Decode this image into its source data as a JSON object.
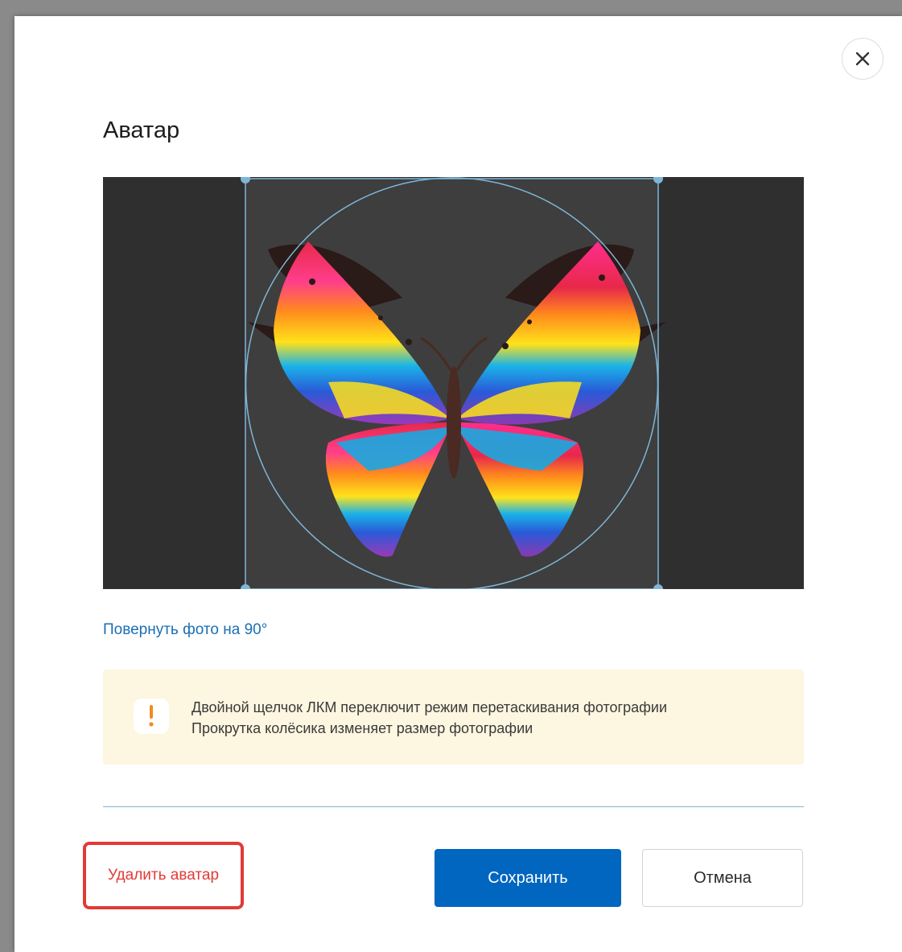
{
  "dialog": {
    "title": "Аватар",
    "close_icon": "close-icon"
  },
  "cropper": {
    "image_subject": "colorful butterfly",
    "selection_shape": "circle",
    "accent_color": "#7fb6d8"
  },
  "rotate_link": "Повернуть фото на 90°",
  "notice": {
    "icon": "exclamation-icon",
    "line1": "Двойной щелчок ЛКМ переключит режим перетаскивания фотографии",
    "line2": "Прокрутка колёсика изменяет размер фотографии"
  },
  "actions": {
    "delete_label": "Удалить аватар",
    "save_label": "Сохранить",
    "cancel_label": "Отмена"
  },
  "colors": {
    "primary": "#0066bf",
    "danger": "#e23a36",
    "link": "#1a6fb5",
    "notice_bg": "#fdf6e0",
    "notice_icon": "#f28c1c"
  }
}
